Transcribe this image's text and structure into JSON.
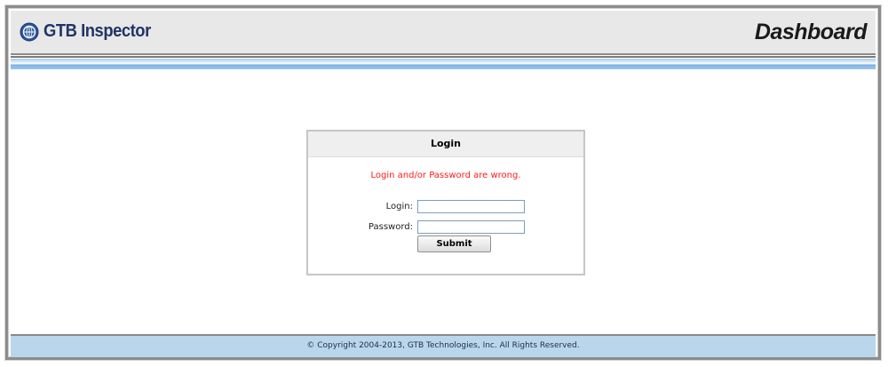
{
  "header": {
    "logo_text": "GTB Inspector",
    "page_title": "Dashboard"
  },
  "login": {
    "heading": "Login",
    "error_message": "Login and/or Password are wrong.",
    "login_label": "Login:",
    "login_value": "",
    "password_label": "Password:",
    "password_value": "",
    "submit_label": "Submit"
  },
  "footer": {
    "copyright": "© Copyright 2004-2013, GTB Technologies, Inc. All Rights Reserved."
  },
  "colors": {
    "error": "#ff1a1a",
    "logo": "#1e3566",
    "footer_bg": "#b9d6ec",
    "header_bg": "#e8e8e8"
  }
}
